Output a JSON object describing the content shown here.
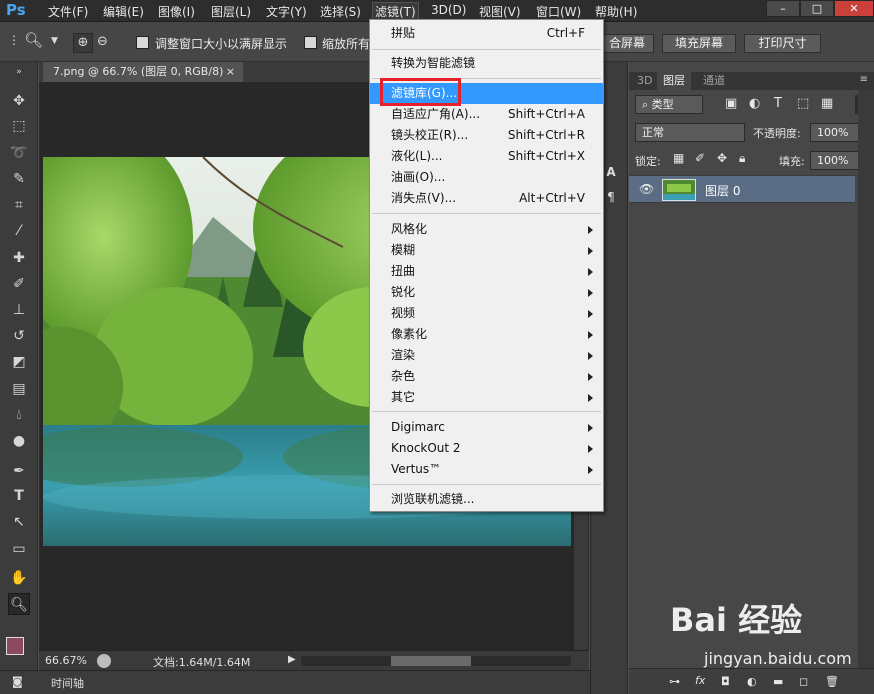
{
  "app": {
    "logo": "Ps",
    "menu": [
      {
        "label": "文件(F)",
        "key": "file"
      },
      {
        "label": "编辑(E)",
        "key": "edit"
      },
      {
        "label": "图像(I)",
        "key": "image"
      },
      {
        "label": "图层(L)",
        "key": "layer"
      },
      {
        "label": "文字(Y)",
        "key": "type"
      },
      {
        "label": "选择(S)",
        "key": "select"
      },
      {
        "label": "滤镜(T)",
        "key": "filter"
      },
      {
        "label": "3D(D)",
        "key": "3d"
      },
      {
        "label": "视图(V)",
        "key": "view"
      },
      {
        "label": "窗口(W)",
        "key": "window"
      },
      {
        "label": "帮助(H)",
        "key": "help"
      }
    ],
    "active_menu": "滤镜(T)",
    "window_controls": [
      "–",
      "□",
      "✕"
    ]
  },
  "options_bar": {
    "resize_windows_label": "调整窗口大小以满屏显示",
    "zoom_all_label": "缩放所有",
    "fill_screen_partial": "合屏幕",
    "fill_screen_button": "填充屏幕",
    "print_size_button": "打印尺寸"
  },
  "document": {
    "tab_title": "7.png @ 66.7% (图层 0, RGB/8)",
    "tab_close": "×",
    "zoom_level": "66.67%",
    "doc_info": "文档:1.64M/1.64M"
  },
  "timeline": {
    "label": "时间轴"
  },
  "layers_panel": {
    "tabs": [
      "3D",
      "图层",
      "通道"
    ],
    "active_tab": "图层",
    "filter_kind": "类型",
    "blend_mode": "正常",
    "opacity_label": "不透明度:",
    "opacity_value": "100%",
    "lock_label": "锁定:",
    "fill_label": "填充:",
    "fill_value": "100%",
    "layers": [
      {
        "name": "图层 0",
        "visible": true
      }
    ]
  },
  "filter_menu": {
    "items": [
      {
        "label": "拼贴",
        "shortcut": "Ctrl+F"
      },
      {
        "separator": true
      },
      {
        "label": "转换为智能滤镜"
      },
      {
        "separator": true
      },
      {
        "label": "滤镜库(G)...",
        "highlighted": true
      },
      {
        "label": "自适应广角(A)...",
        "shortcut": "Shift+Ctrl+A"
      },
      {
        "label": "镜头校正(R)...",
        "shortcut": "Shift+Ctrl+R"
      },
      {
        "label": "液化(L)...",
        "shortcut": "Shift+Ctrl+X"
      },
      {
        "label": "油画(O)..."
      },
      {
        "label": "消失点(V)...",
        "shortcut": "Alt+Ctrl+V"
      },
      {
        "separator": true
      },
      {
        "label": "风格化",
        "submenu": true
      },
      {
        "label": "模糊",
        "submenu": true
      },
      {
        "label": "扭曲",
        "submenu": true
      },
      {
        "label": "锐化",
        "submenu": true
      },
      {
        "label": "视频",
        "submenu": true
      },
      {
        "label": "像素化",
        "submenu": true
      },
      {
        "label": "渲染",
        "submenu": true
      },
      {
        "label": "杂色",
        "submenu": true
      },
      {
        "label": "其它",
        "submenu": true
      },
      {
        "separator": true
      },
      {
        "label": "Digimarc",
        "submenu": true
      },
      {
        "label": "KnockOut 2",
        "submenu": true
      },
      {
        "label": "Vertus™",
        "submenu": true
      },
      {
        "separator": true
      },
      {
        "label": "浏览联机滤镜..."
      }
    ]
  },
  "watermark": {
    "brand": "Bai 经验",
    "url": "jingyan.baidu.com"
  },
  "colors": {
    "highlight": "#3399ff",
    "annotation_box": "#e8202a",
    "layer_selected": "#5b6c85"
  }
}
